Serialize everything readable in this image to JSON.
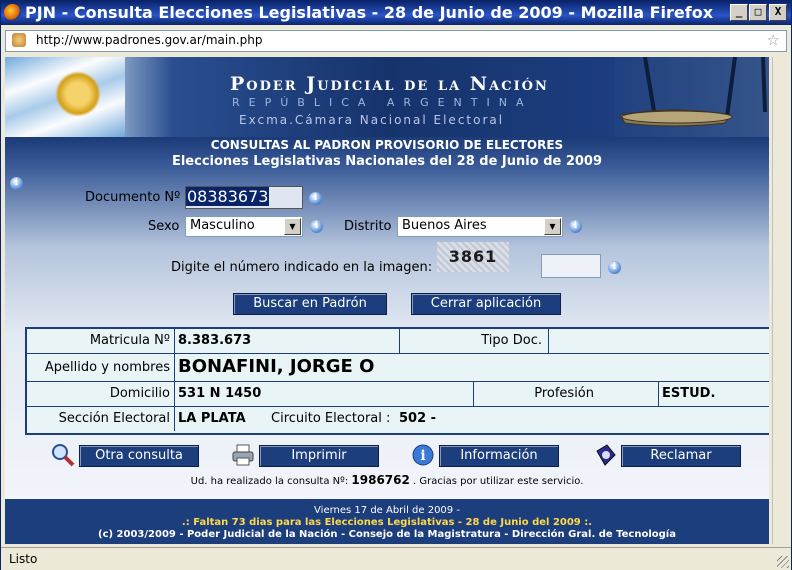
{
  "window": {
    "title": "PJN - Consulta Elecciones Legislativas - 28 de Junio de 2009 - Mozilla Firefox",
    "minimize": "_",
    "maximize": "□",
    "close": "X"
  },
  "browser": {
    "url": "http://www.padrones.gov.ar/main.php",
    "status": "Listo"
  },
  "banner": {
    "title": "Poder Judicial de la Nación",
    "subtitle": "REPÚBLICA ARGENTINA",
    "subtitle2": "Excma.Cámara Nacional Electoral"
  },
  "header": {
    "line1": "CONSULTAS AL PADRON PROVISORIO DE ELECTORES",
    "line2": "Elecciones Legislativas Nacionales del 28 de Junio de 2009"
  },
  "form": {
    "documento_label": "Documento Nº",
    "documento_value": "08383673",
    "sexo_label": "Sexo",
    "sexo_value": "Masculino",
    "distrito_label": "Distrito",
    "distrito_value": "Buenos Aires",
    "captcha_label": "Digite el número indicado en la imagen:",
    "captcha_text": "3861",
    "captcha_value": "",
    "search_button": "Buscar en Padrón",
    "close_button": "Cerrar aplicación"
  },
  "result": {
    "matricula_label": "Matricula Nº",
    "matricula_value": "8.383.673",
    "tipodoc_label": "Tipo Doc.",
    "tipodoc_value": "",
    "nombre_label": "Apellido y nombres",
    "nombre_value": "BONAFINI, JORGE O",
    "domicilio_label": "Domicilio",
    "domicilio_value": "531 N 1450",
    "profesion_label": "Profesión",
    "profesion_value": "ESTUD.",
    "seccion_label": "Sección Electoral",
    "seccion_value": "LA PLATA",
    "circuito_label": "Circuito Electoral :",
    "circuito_value": "502 -"
  },
  "actions": {
    "otra": "Otra consulta",
    "imprimir": "Imprimir",
    "informacion": "Información",
    "reclamar": "Reclamar"
  },
  "counter": {
    "prefix": "Ud. ha realizado la consulta Nº:",
    "number": "1986762",
    "suffix": ". Gracias por utilizar este servicio."
  },
  "footer": {
    "date": "Viernes 17 de Abril de 2009 -",
    "countdown": ".: Faltan 73 dias para las Elecciones Legislativas - 28 de Junio del 2009 :.",
    "copyright": "(c) 2003/2009 - Poder Judicial de la Nación - Consejo de la Magistratura - Dirección Gral. de Tecnología"
  }
}
